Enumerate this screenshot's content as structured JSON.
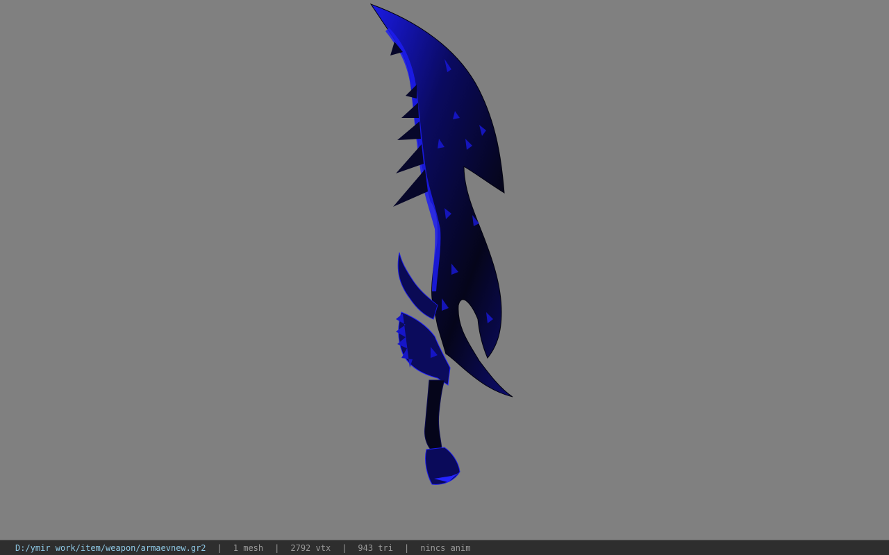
{
  "viewer": {
    "background_color": "#808080",
    "model_colors": {
      "dark": "#05051a",
      "accent": "#1a1ae6"
    }
  },
  "status": {
    "file_path": "D:/ymir work/item/weapon/armaevnew.gr2",
    "mesh_count": "1 mesh",
    "vertex_count": "2792 vtx",
    "triangle_count": "943 tri",
    "anim_status": "nincs anim"
  }
}
